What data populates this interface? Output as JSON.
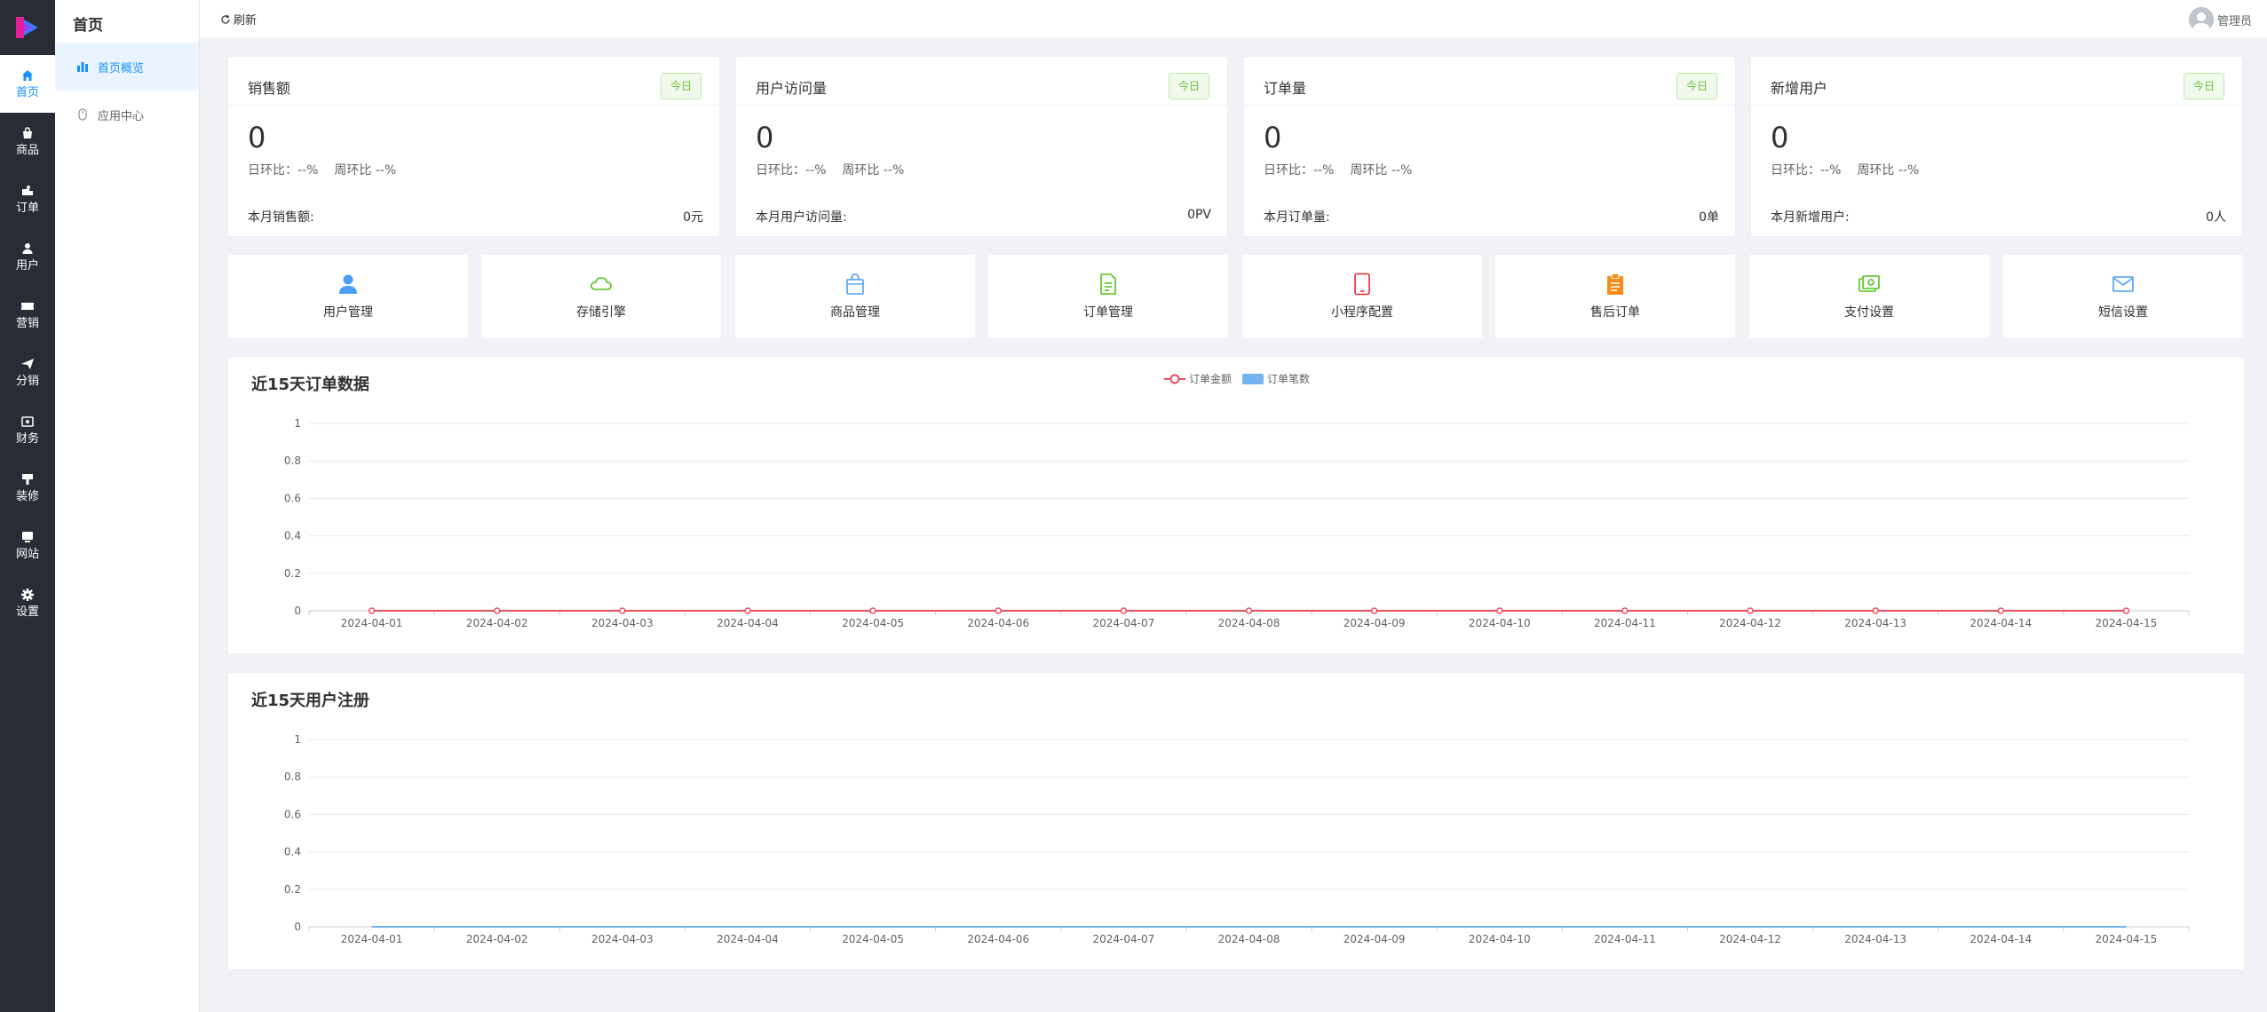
{
  "rail": {
    "items": [
      {
        "label": "首页",
        "icon": "home-icon",
        "active": true
      },
      {
        "label": "商品",
        "icon": "bag-icon"
      },
      {
        "label": "订单",
        "icon": "cart-icon"
      },
      {
        "label": "用户",
        "icon": "user-icon"
      },
      {
        "label": "营销",
        "icon": "ticket-icon"
      },
      {
        "label": "分销",
        "icon": "send-icon"
      },
      {
        "label": "财务",
        "icon": "money-icon"
      },
      {
        "label": "装修",
        "icon": "brush-icon"
      },
      {
        "label": "网站",
        "icon": "monitor-icon"
      },
      {
        "label": "设置",
        "icon": "gear-icon"
      }
    ]
  },
  "subnav": {
    "title": "首页",
    "items": [
      {
        "label": "首页概览",
        "icon": "bar-chart-icon",
        "active": true
      },
      {
        "label": "应用中心",
        "icon": "mouse-icon"
      }
    ]
  },
  "header": {
    "refresh_label": "刷新",
    "user_name": "管理员"
  },
  "stats": [
    {
      "name": "销售额",
      "tag": "今日",
      "value": "0",
      "day_ratio": "日环比：--%",
      "week_ratio": "周环比 --%",
      "foot_label": "本月销售额:",
      "foot_value": "0元"
    },
    {
      "name": "用户访问量",
      "tag": "今日",
      "value": "0",
      "day_ratio": "日环比：--%",
      "week_ratio": "周环比 --%",
      "foot_label": "本月用户访问量:",
      "foot_value": "0PV"
    },
    {
      "name": "订单量",
      "tag": "今日",
      "value": "0",
      "day_ratio": "日环比：--%",
      "week_ratio": "周环比 --%",
      "foot_label": "本月订单量:",
      "foot_value": "0单"
    },
    {
      "name": "新增用户",
      "tag": "今日",
      "value": "0",
      "day_ratio": "日环比：--%",
      "week_ratio": "周环比 --%",
      "foot_label": "本月新增用户:",
      "foot_value": "0人"
    }
  ],
  "shortcuts": [
    {
      "label": "用户管理",
      "icon": "user-icon",
      "color": "#4a9ff5"
    },
    {
      "label": "存储引擎",
      "icon": "cloud-icon",
      "color": "#52c41a"
    },
    {
      "label": "商品管理",
      "icon": "shopping-bag-icon",
      "color": "#4a9ff5"
    },
    {
      "label": "订单管理",
      "icon": "document-icon",
      "color": "#52c41a"
    },
    {
      "label": "小程序配置",
      "icon": "tablet-icon",
      "color": "#f5222d"
    },
    {
      "label": "售后订单",
      "icon": "clipboard-icon",
      "color": "#fa8c16"
    },
    {
      "label": "支付设置",
      "icon": "payment-icon",
      "color": "#52c41a"
    },
    {
      "label": "短信设置",
      "icon": "mail-icon",
      "color": "#4a9ff5"
    }
  ],
  "order_chart": {
    "title": "近15天订单数据",
    "legend": [
      {
        "name": "订单金额",
        "color": "#e8505b",
        "kind": "line"
      },
      {
        "name": "订单笔数",
        "color": "#73b4ee",
        "kind": "bar"
      }
    ]
  },
  "user_chart": {
    "title": "近15天用户注册"
  },
  "chart_data": [
    {
      "type": "line",
      "title": "近15天订单数据",
      "x": [
        "2024-04-01",
        "2024-04-02",
        "2024-04-03",
        "2024-04-04",
        "2024-04-05",
        "2024-04-06",
        "2024-04-07",
        "2024-04-08",
        "2024-04-09",
        "2024-04-10",
        "2024-04-11",
        "2024-04-12",
        "2024-04-13",
        "2024-04-14",
        "2024-04-15"
      ],
      "yticks": [
        "0",
        "0.2",
        "0.4",
        "0.6",
        "0.8",
        "1"
      ],
      "ylim": [
        0,
        1
      ],
      "grid": true,
      "legend_position": "top-center",
      "series": [
        {
          "name": "订单金额",
          "kind": "line",
          "color": "#e8505b",
          "values": [
            0,
            0,
            0,
            0,
            0,
            0,
            0,
            0,
            0,
            0,
            0,
            0,
            0,
            0,
            0
          ]
        },
        {
          "name": "订单笔数",
          "kind": "bar",
          "color": "#73b4ee",
          "values": [
            0,
            0,
            0,
            0,
            0,
            0,
            0,
            0,
            0,
            0,
            0,
            0,
            0,
            0,
            0
          ]
        }
      ]
    },
    {
      "type": "line",
      "title": "近15天用户注册",
      "x": [
        "2024-04-01",
        "2024-04-02",
        "2024-04-03",
        "2024-04-04",
        "2024-04-05",
        "2024-04-06",
        "2024-04-07",
        "2024-04-08",
        "2024-04-09",
        "2024-04-10",
        "2024-04-11",
        "2024-04-12",
        "2024-04-13",
        "2024-04-14",
        "2024-04-15"
      ],
      "yticks": [
        "0",
        "0.2",
        "0.4",
        "0.6",
        "0.8",
        "1"
      ],
      "ylim": [
        0,
        1
      ],
      "grid": true,
      "series": [
        {
          "kind": "line",
          "color": "#73b4ee",
          "values": [
            0,
            0,
            0,
            0,
            0,
            0,
            0,
            0,
            0,
            0,
            0,
            0,
            0,
            0,
            0
          ]
        }
      ]
    }
  ]
}
